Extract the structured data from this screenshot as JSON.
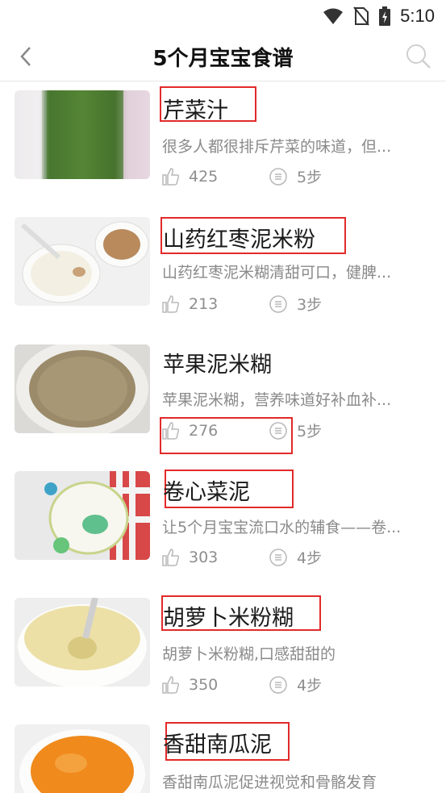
{
  "status": {
    "time": "5:10"
  },
  "header": {
    "title": "5个月宝宝食谱"
  },
  "recipes": [
    {
      "name": "芹菜汁",
      "description": "很多人都很排斥芹菜的味道，但...",
      "likes": "425",
      "steps": "5步"
    },
    {
      "name": "山药红枣泥米粉",
      "description": "山药红枣泥米糊清甜可口，健脾...",
      "likes": "213",
      "steps": "3步"
    },
    {
      "name": "苹果泥米糊",
      "description": "苹果泥米糊，营养味道好补血补...",
      "likes": "276",
      "steps": "5步"
    },
    {
      "name": "卷心菜泥",
      "description": "让5个月宝宝流口水的辅食——卷...",
      "likes": "303",
      "steps": "4步"
    },
    {
      "name": "胡萝卜米粉糊",
      "description": "胡萝卜米粉糊,口感甜甜的",
      "likes": "350",
      "steps": "4步"
    },
    {
      "name": "香甜南瓜泥",
      "description": "香甜南瓜泥促进视觉和骨骼发育",
      "likes": "",
      "steps": ""
    }
  ]
}
